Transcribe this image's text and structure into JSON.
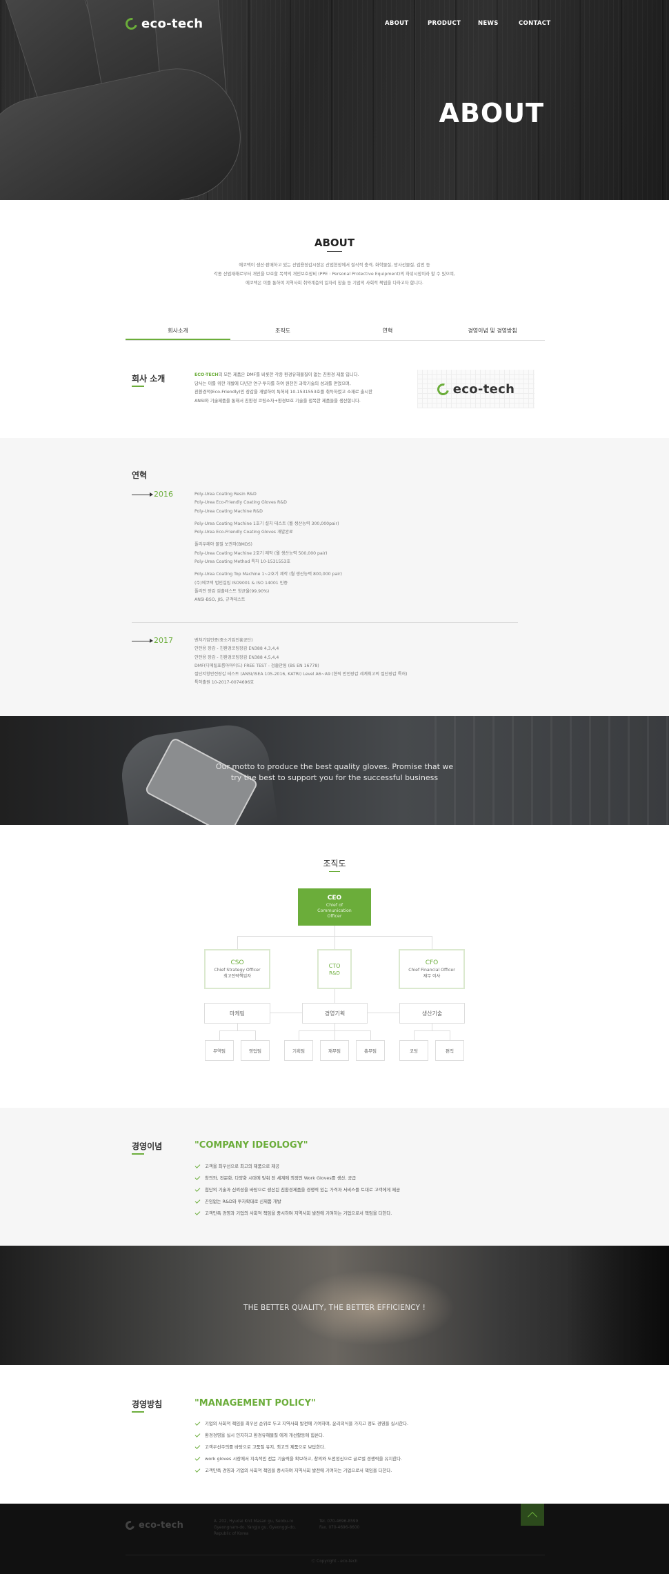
{
  "header": {
    "logo": "eco-tech",
    "nav": [
      "ABOUT",
      "PRODUCT",
      "NEWS",
      "CONTACT"
    ],
    "hero_title": "ABOUT"
  },
  "about": {
    "title": "ABOUT",
    "intro": [
      "에코텍이 생산·판매하고 있는 산업용장갑시장은 산업현장에서 절삭적 충격, 화학물질, 방사선물질, 감전 등",
      "각종 산업재해로부터 개인을 보호할 목적의 개인보호장비 (PPE : Personal Protective Equipment)의 하위시장이라 할 수 있으며,",
      "에코텍은 이를 통하여 지역사회 취약계층의 일자리 창출 등 기업의 사회적 책임을 다하고자 합니다."
    ],
    "tabs": [
      "회사소개",
      "조직도",
      "연혁",
      "경영이념 및 경영방침"
    ]
  },
  "company": {
    "heading": "회사 소개",
    "brand": "ECO-TECH",
    "lines": [
      "의 모든 제품은 DMF를 비롯한 각종 환경유해물질이 없는 친환경 제품 입니다.",
      "당사는 이를 위한 개발에 다년간 연구·투자를 하여 원천인 과학기술의 성과를 얻었으며,",
      "친환경적(Eco-Friendly)인 장갑을 개발하여 특허제 10-1531553호를 취득하였고 소재로 출시한",
      "ANSI와 기술제품을 통해서 친환경 코팅소자+환경보호 기술을 접목한 제품들을 생산합니다."
    ],
    "logo": "eco-tech"
  },
  "history": {
    "heading": "연혁",
    "years": [
      {
        "year": "2016",
        "groups": [
          [
            "Poly-Urea Coating Resin R&D",
            "Poly-Urea Eco-Friendly Coating Gloves R&D",
            "Poly-Urea Coating Machine R&D"
          ],
          [
            "Poly-Urea Coating Machine  1호기 설치 테스트 (월 생산능력  300,000pair)",
            "Poly-Urea Eco-Friendly Coating Gloves 개발완료"
          ],
          [
            "폴리우레아 물질 보관자(BMDS)",
            "Poly-Urea Coating Machine  2호기 제작 (월 생산능력  500,000  pair)",
            "Poly-Urea Coating Method  특허 10-1531553호"
          ],
          [
            "Poly-Urea Coating Top Machine  1~2호기 제작 (월 생산능력  800,000  pair)",
            "(주)에코텍 법인설립 ISO9001 & ISO 14001 인증",
            "폴리안 장갑 검출테스트 항균율(99.90%)",
            "ANSI-BSO, JIS, 규격테스트"
          ]
        ]
      },
      {
        "year": "2017",
        "groups": [
          [
            "벤처기업인증(중소기업진흥공단)",
            "안전용 장갑 - 친환경코팅장갑 EN388 4,3,4,4",
            "안전용 장갑 - 친환경코팅장갑 EN388 4,5,4,4",
            "DMF(디메틸포름아마이드) FREE TEST - 검출안됨 (BS EN 16778)",
            "절단저항안전장갑 테스트 (ANSI/ISEA 105-2016, KATRI) Level A6~A9 (현직 안전장갑 세계최고의 절단장갑 특허)",
            "특허출원 10-2017-0074696호"
          ]
        ]
      }
    ]
  },
  "banner1": {
    "line1": "Our motto to produce the best quality gloves. Promise that we",
    "line2": "try the best to support you for the successful business"
  },
  "org": {
    "title": "조직도",
    "ceo": {
      "title": "CEO",
      "sub": "Chief of Communication Officer"
    },
    "cso": {
      "title": "CSO",
      "sub1": "Chief Strategy Officer",
      "sub2": "최고전략책임자"
    },
    "cto": {
      "title": "CTO",
      "sub1": "R&D"
    },
    "cfo": {
      "title": "CFO",
      "sub1": "Chief Financial Officer",
      "sub2": "재무 이사"
    },
    "mid": [
      "마케팅",
      "경영기획",
      "생산기술"
    ],
    "leaf": [
      "무역팀",
      "영업팀",
      "기획팀",
      "재무팀",
      "총무팀",
      "코팅",
      "편직"
    ]
  },
  "ideology": {
    "heading": "경영이념",
    "quote": "\"COMPANY IDEOLOGY\"",
    "items": [
      "고객을 최우선으로 최고의 제품으로 제공",
      "창의와, 전문화, 다양화 시대에 맞춰 전 세계에 최정인 Work Gloves를 생산, 공급",
      "첨단의 기술과 신뢰성을 바탕으로 생산된 친환경제품을 경쟁력 있는 가격과 서비스를 토대로 고객에게 제공",
      "끈임없는 R&D와 투자확대로 신제품 개발",
      "고객만족 경영과 기업의 사회적 책임을 중시하며 지역사회 발전에 기여하는 기업으로서 책임을 다한다."
    ]
  },
  "banner2": {
    "text": "THE BETTER QUALITY, THE BETTER EFFICIENCY !"
  },
  "policy": {
    "heading": "경영방침",
    "quote": "\"MANAGEMENT POLICY\"",
    "items": [
      "기업의 사회적 책임을 최우선 순위로 두고 지역사회 발전에 기여하며, 윤리의식을 가지고 정도 경영을 실시한다.",
      "환경경영을 실시 인지하고 환경유해물질 에게 개선활동에 힘쓴다.",
      "고객우선주의를 바탕으로 고품질 유지, 최고의 제품으로 보답한다.",
      "work gloves 시장에서 지속적인 전문 기술력을 확보하고, 창의와 도전정신으로 글로벌 경쟁력을 유지한다.",
      "고객만족 경영과 기업의 사회적 책임을 중시하며 지역사회 발전에 기여하는 기업으로서 책임을 다한다."
    ]
  },
  "footer": {
    "logo": "eco-tech",
    "address": [
      "A. 202, Hyudai Knit Masan gu, Seobu-ro",
      "Gyeongnam-do, Yangju gu, Gyeonggi-do,",
      "Republic of Korea"
    ],
    "contact": [
      "Tel. 070-4696-8599",
      "Fax. 070-4696-8600"
    ],
    "copyright": "ⓒ Copyright - eco-tech"
  },
  "colors": {
    "accent": "#6bad3a",
    "dark": "#111111",
    "light_bg": "#f6f6f6"
  }
}
